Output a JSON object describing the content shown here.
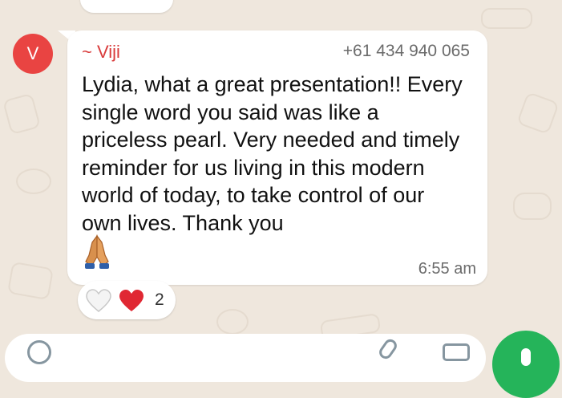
{
  "message": {
    "avatar_letter": "V",
    "sender": "~ Viji",
    "phone": "+61 434 940 065",
    "text": "Lydia, what a great presentation!! Every single word you said was like a priceless pearl. Very needed and timely reminder for us living in this modern world of today, to take control of our own lives. Thank you",
    "emoji": "folded-hands",
    "time": "6:55 am"
  },
  "reactions": {
    "items": [
      "white-heart",
      "red-heart"
    ],
    "count": "2"
  },
  "colors": {
    "background": "#efe7dd",
    "bubble": "#ffffff",
    "avatar": "#e94442",
    "sender": "#d93b3b",
    "mic_button": "#25b45a"
  },
  "composer": {
    "icons": [
      "emoji-icon",
      "attach-icon",
      "camera-icon",
      "mic-icon"
    ]
  }
}
